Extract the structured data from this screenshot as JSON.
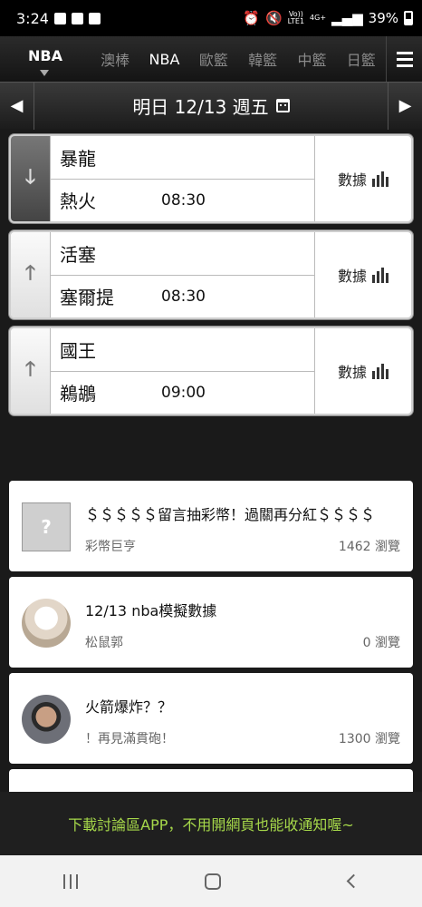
{
  "status_bar": {
    "time": "3:24",
    "battery": "39%",
    "network_top": "Vo))",
    "network_bottom": "LTE1",
    "signal_label": "4G+"
  },
  "league_nav": {
    "active": "NBA",
    "tabs": [
      "澳棒",
      "NBA",
      "歐籃",
      "韓籃",
      "中籃",
      "日籃"
    ]
  },
  "date_bar": {
    "date": "明日 12/13 週五"
  },
  "games": [
    {
      "team1": "暴龍",
      "team2": "熱火",
      "time": "08:30",
      "stats_label": "數據",
      "arrow": "down"
    },
    {
      "team1": "活塞",
      "team2": "塞爾提",
      "time": "08:30",
      "stats_label": "數據",
      "arrow": "up"
    },
    {
      "team1": "國王",
      "team2": "鵜鶘",
      "time": "09:00",
      "stats_label": "數據",
      "arrow": "up"
    }
  ],
  "posts": [
    {
      "title": "＄＄＄＄＄留言抽彩幣！過關再分紅＄＄＄＄",
      "author": "彩幣巨亨",
      "views": "1462 瀏覽"
    },
    {
      "title": "12/13 nba模擬數據",
      "author": "松鼠郭",
      "views": "0 瀏覽"
    },
    {
      "title": "火箭爆炸？？",
      "author": "！再見滿貫砲！",
      "views": "1300 瀏覽"
    }
  ],
  "promo": {
    "text": "下載討論區APP，不用開網頁也能收通知喔~"
  },
  "colors": {
    "promo_text": "#a6d84a",
    "background": "#1a1a1a"
  }
}
